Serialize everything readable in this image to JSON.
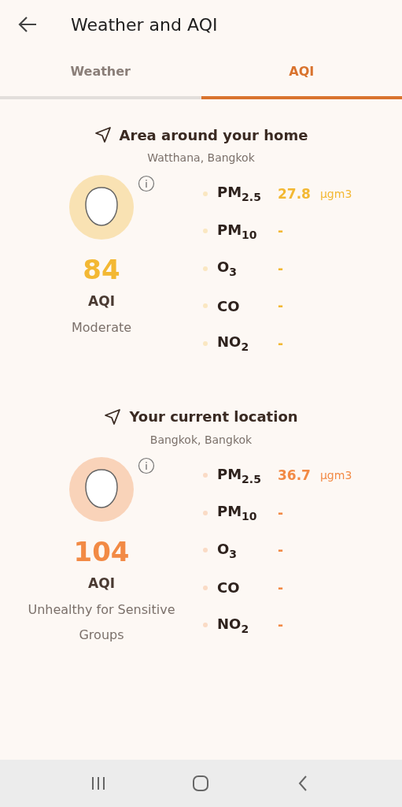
{
  "header": {
    "title": "Weather and AQI"
  },
  "tabs": [
    {
      "label": "Weather",
      "selected": false
    },
    {
      "label": "AQI",
      "selected": true
    }
  ],
  "locations": [
    {
      "title": "Area around your home",
      "subtitle": "Watthana, Bangkok",
      "aqi": "84",
      "aqi_label": "AQI",
      "category": "Moderate",
      "color": "#f3b833",
      "pollutants": [
        {
          "name": "PM$_{2.5}$",
          "value": "27.8",
          "unit": "µgm3"
        },
        {
          "name": "PM$_{10}$",
          "value": "-"
        },
        {
          "name": "O$_{3}$",
          "value": "-"
        },
        {
          "name": "CO",
          "value": "-"
        },
        {
          "name": "NO$_{2}$",
          "value": "-"
        }
      ]
    },
    {
      "title": "Your current location",
      "subtitle": "Bangkok, Bangkok",
      "aqi": "104",
      "aqi_label": "AQI",
      "category": "Unhealthy for Sensitive Groups",
      "color": "#f28a45",
      "pollutants": [
        {
          "name": "PM$_{2.5}$",
          "value": "36.7",
          "unit": "µgm3"
        },
        {
          "name": "PM$_{10}$",
          "value": "-"
        },
        {
          "name": "O$_{3}$",
          "value": "-"
        },
        {
          "name": "CO",
          "value": "-"
        },
        {
          "name": "NO$_{2}$",
          "value": "-"
        }
      ]
    }
  ]
}
